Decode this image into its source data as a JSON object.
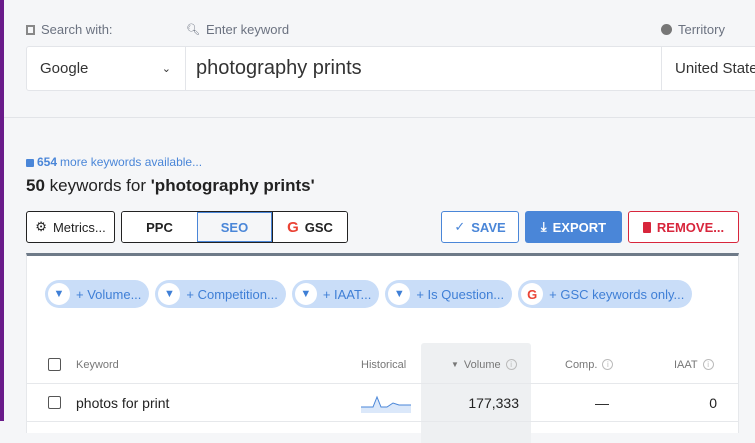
{
  "search": {
    "search_with_label": "Search with:",
    "keyword_label": "Enter keyword",
    "territory_label": "Territory",
    "engine": "Google",
    "keyword": "photography prints",
    "territory": "United States"
  },
  "summary": {
    "more_count": "654",
    "more_text": "more keywords available...",
    "count": "50",
    "middle": "keywords for",
    "query": "'photography prints'"
  },
  "toolbar": {
    "metrics": "Metrics...",
    "ppc": "PPC",
    "seo": "SEO",
    "gsc": "GSC",
    "save": "SAVE",
    "export": "EXPORT",
    "remove": "REMOVE..."
  },
  "filters": [
    "+ Volume...",
    "+ Competition...",
    "+ IAAT...",
    "+ Is Question...",
    "+ GSC keywords only..."
  ],
  "table": {
    "headers": {
      "keyword": "Keyword",
      "historical": "Historical",
      "volume": "Volume",
      "comp": "Comp.",
      "iaat": "IAAT"
    },
    "rows": [
      {
        "keyword": "photos for print",
        "volume": "177,333",
        "comp": "—",
        "iaat": "0"
      }
    ]
  },
  "colors": {
    "accent": "#4a86d8",
    "danger": "#d8263c",
    "sidebar": "#6a1b8a"
  }
}
